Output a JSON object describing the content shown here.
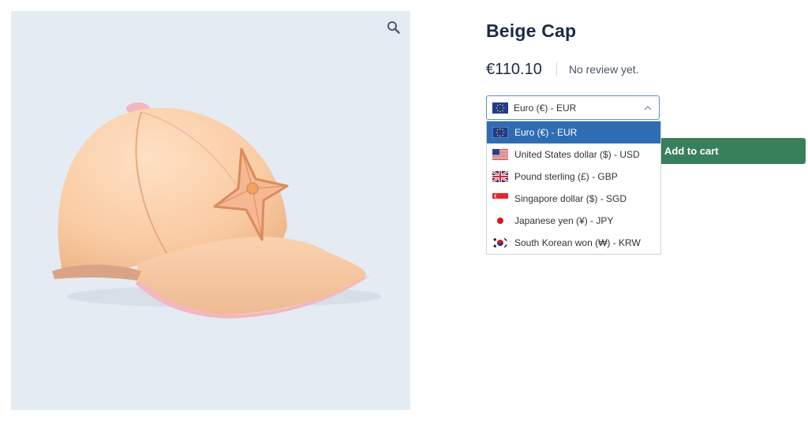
{
  "product": {
    "title": "Beige Cap",
    "price": "€110.10",
    "review_text": "No review yet."
  },
  "currency_select": {
    "selected_label": "Euro (€) - EUR",
    "options": [
      {
        "label": "Euro (€) - EUR",
        "flag": "eu-flag-icon",
        "selected": true
      },
      {
        "label": "United States dollar ($) - USD",
        "flag": "us-flag-icon",
        "selected": false
      },
      {
        "label": "Pound sterling (£) - GBP",
        "flag": "uk-flag-icon",
        "selected": false
      },
      {
        "label": "Singapore dollar ($) - SGD",
        "flag": "sg-flag-icon",
        "selected": false
      },
      {
        "label": "Japanese yen (¥) - JPY",
        "flag": "jp-flag-icon",
        "selected": false
      },
      {
        "label": "South Korean won (₩) - KRW",
        "flag": "kr-flag-icon",
        "selected": false
      }
    ]
  },
  "cart": {
    "add_label": "Add to cart"
  },
  "colors": {
    "title": "#1c2b45",
    "add_to_cart_bg": "#38805b",
    "selected_option_bg": "#2e6db4",
    "gallery_bg": "#e5ebf3"
  }
}
